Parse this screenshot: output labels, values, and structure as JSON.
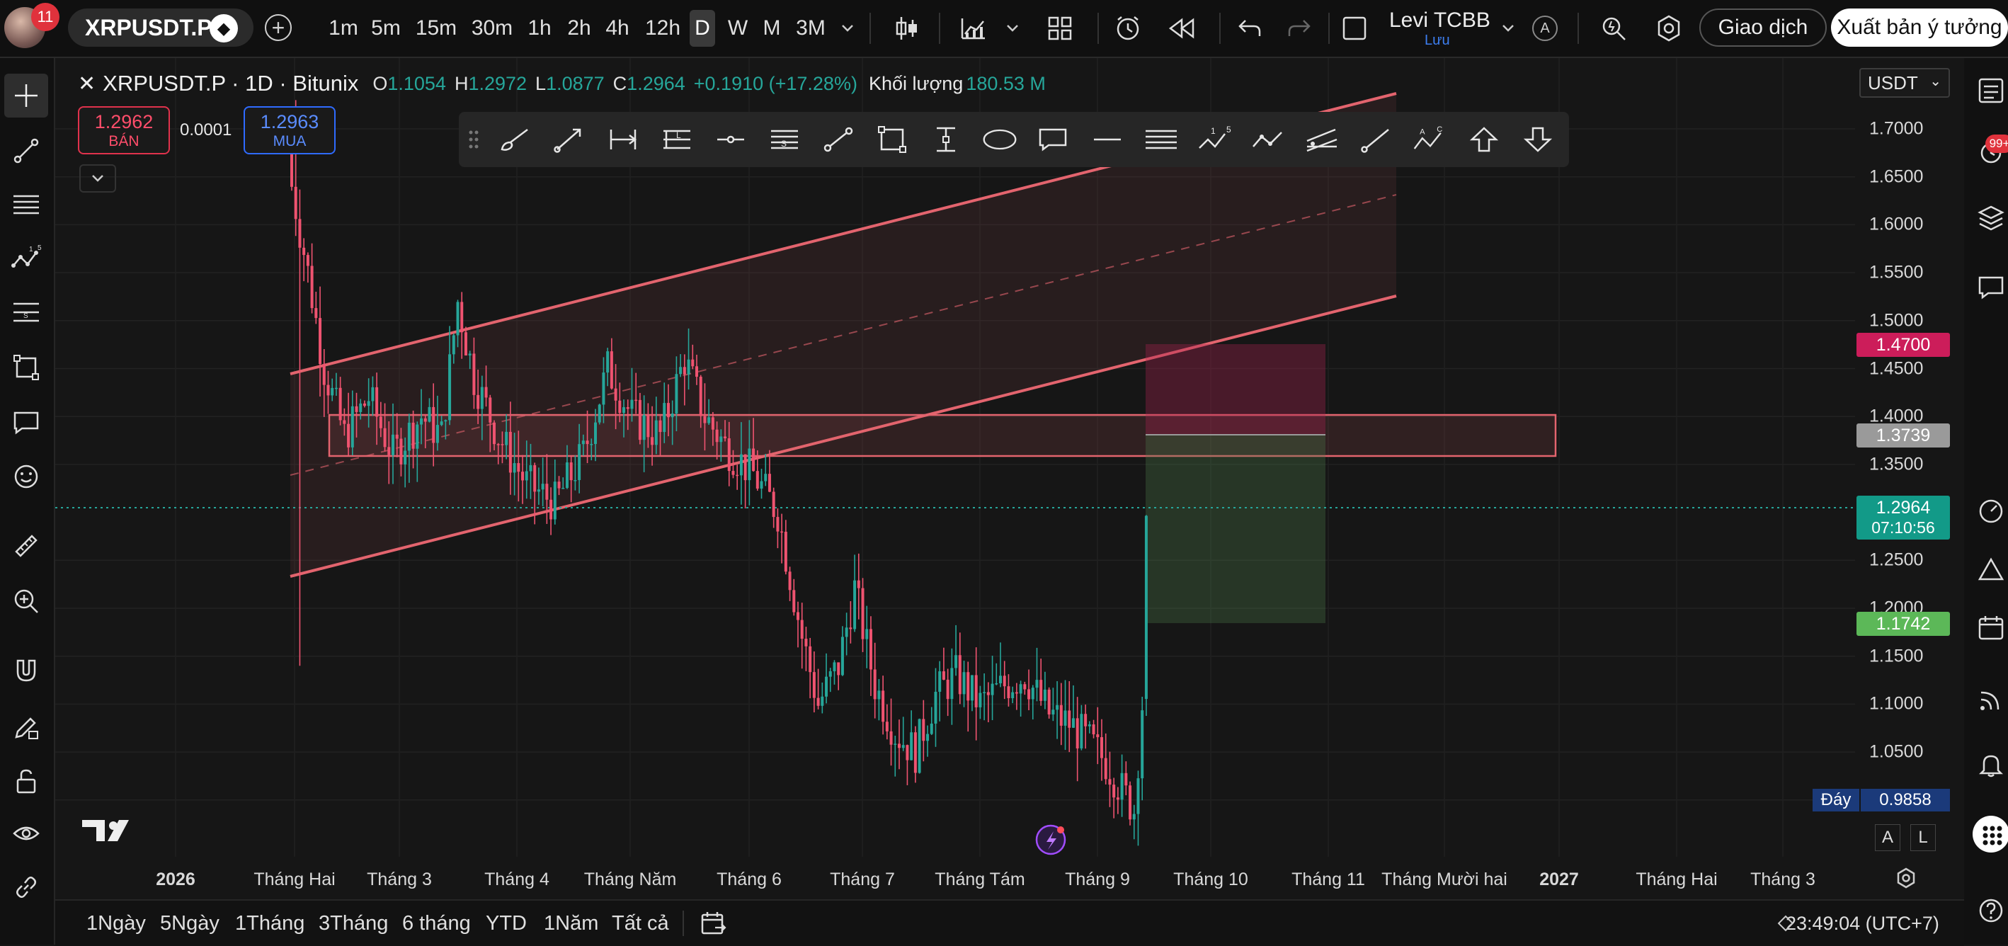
{
  "topbar": {
    "notification_count": "11",
    "symbol": "XRPUSDT.P",
    "intervals": [
      "1m",
      "5m",
      "15m",
      "30m",
      "1h",
      "2h",
      "4h",
      "12h",
      "D",
      "W",
      "M",
      "3M"
    ],
    "active_interval": "D",
    "layout_name": "Levi TCBB",
    "layout_status": "Lưu",
    "avatar_letter": "A",
    "trade_button": "Giao dịch",
    "publish_button": "Xuất bản ý tưởng"
  },
  "legend": {
    "title": "XRPUSDT.P · 1D · Bitunix",
    "o_label": "O",
    "o_value": "1.1054",
    "h_label": "H",
    "h_value": "1.2972",
    "l_label": "L",
    "l_value": "1.0877",
    "c_label": "C",
    "c_value": "1.2964",
    "change": "+0.1910 (+17.28%)",
    "volume_label": "Khối lượng",
    "volume_value": "180.53 M"
  },
  "trade": {
    "sell_price": "1.2962",
    "sell_label": "BÁN",
    "spread": "0.0001",
    "buy_price": "1.2963",
    "buy_label": "MUA"
  },
  "price_axis": {
    "currency": "USDT",
    "ticks": [
      "1.7000",
      "1.6500",
      "1.6000",
      "1.5500",
      "1.5000",
      "1.4500",
      "1.4000",
      "1.3500",
      "1.2500",
      "1.2000",
      "1.1500",
      "1.1000",
      "1.0500",
      "1.0000"
    ],
    "labels": {
      "target": "1.4700",
      "entry": "1.3739",
      "current_price": "1.2964",
      "countdown": "07:10:56",
      "stop": "1.1742",
      "low_label": "Đáy",
      "low_value": "0.9858"
    }
  },
  "time_axis": {
    "ticks": [
      "2026",
      "Tháng Hai",
      "Tháng 3",
      "Tháng 4",
      "Tháng Năm",
      "Tháng 6",
      "Tháng 7",
      "Tháng Tám",
      "Tháng 9",
      "Tháng 10",
      "Tháng 11",
      "Tháng Mười hai",
      "2027",
      "Tháng Hai",
      "Tháng 3"
    ]
  },
  "bottombar": {
    "ranges": [
      "1Ngày",
      "5Ngày",
      "1Tháng",
      "3Tháng",
      "6 tháng",
      "YTD",
      "1Năm",
      "Tất cả"
    ],
    "clock": "23:49:04 (UTC+7)",
    "scale_a": "A",
    "scale_l": "L"
  },
  "drawing_tools": [
    "brush",
    "arrow-line",
    "price-range",
    "long-position",
    "horizontal-ray",
    "fib-retracement",
    "trend-line",
    "rectangle",
    "date-range",
    "ellipse",
    "callout",
    "horizontal-line",
    "parallel-channel",
    "elliott-wave",
    "path",
    "pitchfork",
    "ray",
    "abcd-pattern",
    "arrow-up",
    "arrow-down"
  ],
  "colors": {
    "up": "#26a69a",
    "down": "#ef5370",
    "channel": "#e3646e",
    "target_label": "#cc1d5a",
    "current_label": "#129a88",
    "stop_label": "#5cb858",
    "low_label": "#1b3a7a"
  },
  "chart_data": {
    "type": "candlestick",
    "x_start": "2026-01-26",
    "y_range": [
      0.97,
      1.73
    ],
    "summary_series": {
      "name": "XRPUSDT.P",
      "points": [
        [
          "2026-01-26",
          1.64
        ],
        [
          "2026-01-30",
          1.55
        ],
        [
          "2026-02-03",
          1.45
        ],
        [
          "2026-02-08",
          1.38
        ],
        [
          "2026-02-14",
          1.42
        ],
        [
          "2026-02-20",
          1.36
        ],
        [
          "2026-02-27",
          1.4
        ],
        [
          "2026-03-04",
          1.38
        ],
        [
          "2026-03-08",
          1.52
        ],
        [
          "2026-03-12",
          1.44
        ],
        [
          "2026-03-18",
          1.38
        ],
        [
          "2026-03-25",
          1.33
        ],
        [
          "2026-04-01",
          1.31
        ],
        [
          "2026-04-08",
          1.36
        ],
        [
          "2026-04-14",
          1.45
        ],
        [
          "2026-04-20",
          1.4
        ],
        [
          "2026-04-27",
          1.38
        ],
        [
          "2026-05-03",
          1.46
        ],
        [
          "2026-05-08",
          1.4
        ],
        [
          "2026-05-13",
          1.37
        ],
        [
          "2026-05-20",
          1.34
        ],
        [
          "2026-05-26",
          1.3
        ],
        [
          "2026-06-01",
          1.17
        ],
        [
          "2026-06-05",
          1.1
        ],
        [
          "2026-06-10",
          1.14
        ],
        [
          "2026-06-14",
          1.22
        ],
        [
          "2026-06-19",
          1.12
        ],
        [
          "2026-06-24",
          1.07
        ],
        [
          "2026-06-29",
          1.05
        ],
        [
          "2026-07-04",
          1.11
        ],
        [
          "2026-07-09",
          1.13
        ],
        [
          "2026-07-15",
          1.1
        ],
        [
          "2026-07-21",
          1.12
        ],
        [
          "2026-07-26",
          1.13
        ],
        [
          "2026-08-01",
          1.09
        ],
        [
          "2026-08-06",
          1.08
        ],
        [
          "2026-08-11",
          1.06
        ],
        [
          "2026-08-15",
          1.04
        ],
        [
          "2026-08-19",
          1.01
        ],
        [
          "2026-08-22",
          0.99
        ],
        [
          "2026-08-24",
          1.1
        ],
        [
          "2026-08-25",
          1.2964
        ]
      ]
    },
    "last_candle": {
      "open": 1.1054,
      "high": 1.2972,
      "low": 1.0877,
      "close": 1.2964
    }
  }
}
